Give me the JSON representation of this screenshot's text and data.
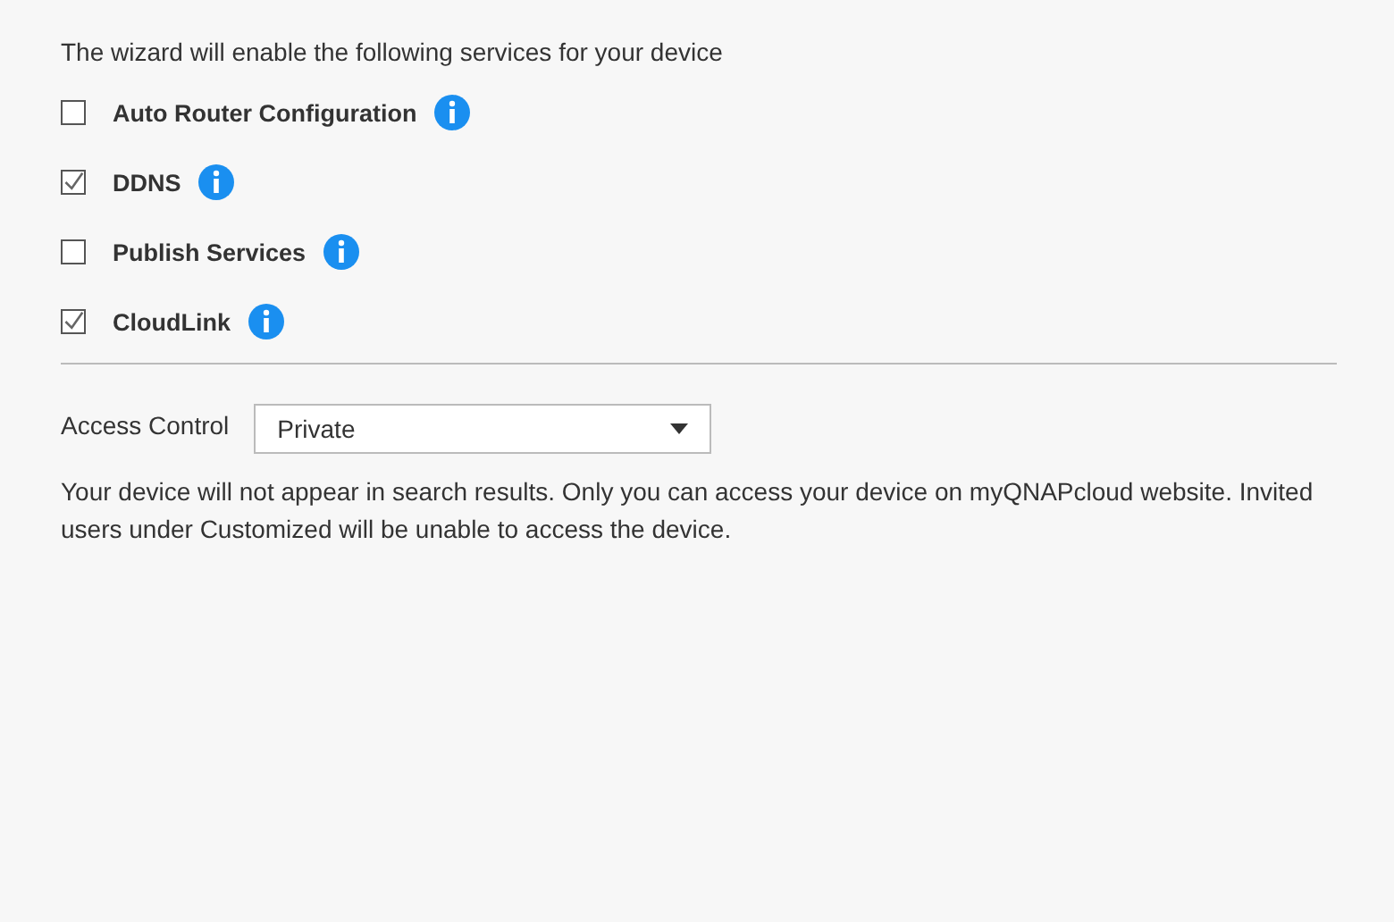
{
  "intro": "The wizard will enable the following services for your device",
  "services": [
    {
      "label": "Auto Router Configuration",
      "checked": false
    },
    {
      "label": "DDNS",
      "checked": true
    },
    {
      "label": "Publish Services",
      "checked": false
    },
    {
      "label": "CloudLink",
      "checked": true
    }
  ],
  "access_control": {
    "label": "Access Control",
    "value": "Private"
  },
  "description": "Your device will not appear in search results. Only you can access your device on myQNAPcloud website. Invited users under Customized will be unable to access the device."
}
